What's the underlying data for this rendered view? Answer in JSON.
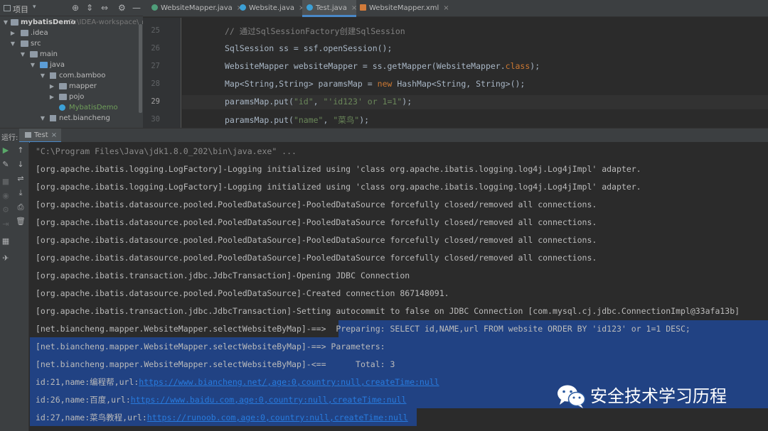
{
  "project_panel": {
    "title": "项目",
    "tree": [
      {
        "label": "mybatisDemo",
        "hint": "D:\\IDEA-workspace\\myb",
        "bold": true
      },
      {
        "label": ".idea"
      },
      {
        "label": "src"
      },
      {
        "label": "main"
      },
      {
        "label": "java"
      },
      {
        "label": "com.bamboo"
      },
      {
        "label": "mapper"
      },
      {
        "label": "pojo"
      },
      {
        "label": "MybatisDemo"
      },
      {
        "label": "net.biancheng"
      }
    ]
  },
  "editor": {
    "tabs": [
      {
        "label": "WebsiteMapper.java",
        "active": false,
        "icon_color": "#4f9e7a"
      },
      {
        "label": "Website.java",
        "active": false,
        "icon_color": "#3ca0d6"
      },
      {
        "label": "Test.java",
        "active": true,
        "icon_color": "#3ca0d6"
      },
      {
        "label": "WebsiteMapper.xml",
        "active": false,
        "icon_color": "#d27b3a"
      }
    ],
    "line_numbers": [
      "25",
      "26",
      "27",
      "28",
      "29",
      "30"
    ],
    "current_line": "29",
    "code": {
      "l25": "// 通过SqlSessionFactory创建SqlSession",
      "l26": "SqlSession ss = ssf.openSession();",
      "l27a": "WebsiteMapper websiteMapper = ss.getMapper(WebsiteMapper.",
      "l27b": "class",
      "l27c": ");",
      "l28a": "Map<String,String> paramsMap = ",
      "l28b": "new",
      "l28c": " HashMap<String, String>();",
      "l29a": "paramsMap.put(",
      "l29b": "\"id\"",
      "l29c": ", ",
      "l29d": "\"'id123' or 1=1\"",
      "l29e": ");",
      "l30a": "paramsMap.put(",
      "l30b": "\"name\"",
      "l30c": ", ",
      "l30d": "\"菜鸟\"",
      "l30e": ");"
    }
  },
  "run_panel": {
    "label": "运行:",
    "tab_label": "Test",
    "console": {
      "cmd": "\"C:\\Program Files\\Java\\jdk1.8.0_202\\bin\\java.exe\" ...",
      "log1": "[org.apache.ibatis.logging.LogFactory]-Logging initialized using 'class org.apache.ibatis.logging.log4j.Log4jImpl' adapter.",
      "log2": "[org.apache.ibatis.logging.LogFactory]-Logging initialized using 'class org.apache.ibatis.logging.log4j.Log4jImpl' adapter.",
      "pool1": "[org.apache.ibatis.datasource.pooled.PooledDataSource]-PooledDataSource forcefully closed/removed all connections.",
      "pool2": "[org.apache.ibatis.datasource.pooled.PooledDataSource]-PooledDataSource forcefully closed/removed all connections.",
      "pool3": "[org.apache.ibatis.datasource.pooled.PooledDataSource]-PooledDataSource forcefully closed/removed all connections.",
      "pool4": "[org.apache.ibatis.datasource.pooled.PooledDataSource]-PooledDataSource forcefully closed/removed all connections.",
      "open": "[org.apache.ibatis.transaction.jdbc.JdbcTransaction]-Opening JDBC Connection",
      "created": "[org.apache.ibatis.datasource.pooled.PooledDataSource]-Created connection 867148091.",
      "autocommit": "[org.apache.ibatis.transaction.jdbc.JdbcTransaction]-Setting autocommit to false on JDBC Connection [com.mysql.cj.jdbc.ConnectionImpl@33afa13b]",
      "prep_a": "[net.biancheng.mapper.WebsiteMapper.selectWebsiteByMap]-==>  ",
      "prep_b": "Preparing: SELECT id,NAME,url FROM website ORDER BY 'id123' or 1=1 DESC;",
      "params": "[net.biancheng.mapper.WebsiteMapper.selectWebsiteByMap]-==> Parameters: ",
      "total": "[net.biancheng.mapper.WebsiteMapper.selectWebsiteByMap]-<==      Total: 3",
      "r1a": "id:21,name:编程帮,url:",
      "r1b": "https://www.biancheng.net/,age:0,country:null,createTime:null",
      "r2a": "id:26,name:百度,url:",
      "r2b": "https://www.baidu.com,age:0,country:null,createTime:null",
      "r3a": "id:27,name:菜鸟教程,url:",
      "r3b": "https://runoob.com,age:0,country:null,createTime:null"
    }
  },
  "watermark": {
    "text": "安全技术学习历程"
  },
  "colors": {
    "selection": "#214283",
    "link": "#287bde",
    "keyword": "#cc7832",
    "string": "#6a8759",
    "comment": "#808080"
  }
}
